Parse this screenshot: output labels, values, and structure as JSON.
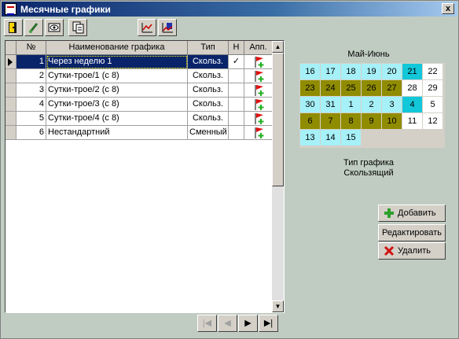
{
  "window": {
    "title": "Месячные графики",
    "close_glyph": "x"
  },
  "toolbar": {
    "buttons": [
      {
        "name": "open-door-icon"
      },
      {
        "name": "brush-icon"
      },
      {
        "name": "view-icon"
      },
      {
        "name": "copy-document-icon"
      },
      {
        "name": "chart-icon"
      },
      {
        "name": "chart-edit-icon"
      }
    ]
  },
  "table": {
    "columns": [
      "№",
      "Наименование графика",
      "Тип",
      "Н",
      "Апп."
    ],
    "rows": [
      {
        "num": "1",
        "name": "Через неделю 1",
        "type": "Скольз.",
        "h": "✓",
        "selected": true
      },
      {
        "num": "2",
        "name": "Сутки-трое/1  (с 8)",
        "type": "Скольз.",
        "h": ""
      },
      {
        "num": "3",
        "name": "Сутки-трое/2  (с 8)",
        "type": "Скольз.",
        "h": ""
      },
      {
        "num": "4",
        "name": "Сутки-трое/3  (с 8)",
        "type": "Скольз.",
        "h": ""
      },
      {
        "num": "5",
        "name": "Сутки-трое/4  (с 8)",
        "type": "Скольз.",
        "h": ""
      },
      {
        "num": "6",
        "name": "Нестандартний",
        "type": "Сменный",
        "h": ""
      }
    ]
  },
  "nav": {
    "first": "|◀",
    "prev": "◀",
    "next": "▶",
    "last": "▶|"
  },
  "calendar": {
    "title": "Май-Июнь",
    "days": [
      {
        "d": "16",
        "c": "cyan"
      },
      {
        "d": "17",
        "c": "cyan"
      },
      {
        "d": "18",
        "c": "cyan"
      },
      {
        "d": "19",
        "c": "cyan"
      },
      {
        "d": "20",
        "c": "cyan"
      },
      {
        "d": "21",
        "c": "teal"
      },
      {
        "d": "22",
        "c": "white"
      },
      {
        "d": "23",
        "c": "olive"
      },
      {
        "d": "24",
        "c": "olive"
      },
      {
        "d": "25",
        "c": "olive"
      },
      {
        "d": "26",
        "c": "olive"
      },
      {
        "d": "27",
        "c": "olive"
      },
      {
        "d": "28",
        "c": "white"
      },
      {
        "d": "29",
        "c": "white"
      },
      {
        "d": "30",
        "c": "cyan"
      },
      {
        "d": "31",
        "c": "cyan"
      },
      {
        "d": "1",
        "c": "cyan"
      },
      {
        "d": "2",
        "c": "cyan"
      },
      {
        "d": "3",
        "c": "cyan"
      },
      {
        "d": "4",
        "c": "teal"
      },
      {
        "d": "5",
        "c": "white"
      },
      {
        "d": "6",
        "c": "olive"
      },
      {
        "d": "7",
        "c": "olive"
      },
      {
        "d": "8",
        "c": "olive"
      },
      {
        "d": "9",
        "c": "olive"
      },
      {
        "d": "10",
        "c": "olive"
      },
      {
        "d": "11",
        "c": "white"
      },
      {
        "d": "12",
        "c": "white"
      },
      {
        "d": "13",
        "c": "cyan"
      },
      {
        "d": "14",
        "c": "cyan"
      },
      {
        "d": "15",
        "c": "cyan"
      }
    ]
  },
  "schedule_type": {
    "label": "Тип графика",
    "value": "Скользящий"
  },
  "actions": {
    "add": "Добавить",
    "edit": "Редактировать",
    "delete": "Удалить"
  },
  "colors": {
    "cyan": "#a6f0f8",
    "olive": "#908c00",
    "teal": "#12c7d8",
    "selection": "#0a246a"
  }
}
